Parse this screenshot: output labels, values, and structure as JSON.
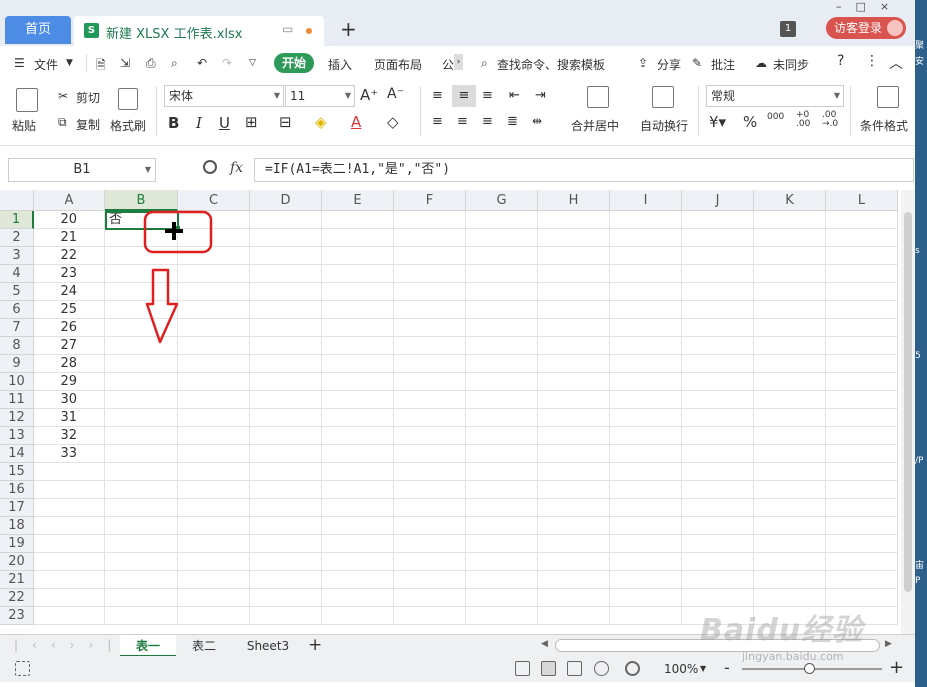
{
  "tabs": {
    "home_label": "首页",
    "file_label": "新建 XLSX 工作表.xlsx",
    "file_icon": "S",
    "new_tab": "+",
    "window_count": "1",
    "login_label": "访客登录"
  },
  "menu": {
    "items": [
      "文件",
      "开始",
      "插入",
      "页面布局",
      "公",
      "查找命令、搜索模板",
      "分享",
      "批注",
      "未同步"
    ],
    "help": "?",
    "more": "⋮"
  },
  "ribbon": {
    "paste": "粘贴",
    "cut": "剪切",
    "copy": "复制",
    "format_painter": "格式刷",
    "font_name": "宋体",
    "font_size": "11",
    "bold": "B",
    "italic": "I",
    "underline": "U",
    "merge_center": "合并居中",
    "wrap_text": "自动换行",
    "number_format": "常规",
    "percent": "%",
    "conditional_format": "条件格式"
  },
  "formula_bar": {
    "name_box": "B1",
    "fx": "fx",
    "formula": "=IF(A1=表二!A1,\"是\",\"否\")"
  },
  "grid": {
    "columns": [
      "A",
      "B",
      "C",
      "D",
      "E",
      "F",
      "G",
      "H",
      "I",
      "J",
      "K",
      "L"
    ],
    "rows": [
      "1",
      "2",
      "3",
      "4",
      "5",
      "6",
      "7",
      "8",
      "9",
      "10",
      "11",
      "12",
      "13",
      "14",
      "15",
      "16",
      "17",
      "18",
      "19",
      "20",
      "21",
      "22",
      "23"
    ],
    "col_a_values": [
      "20",
      "21",
      "22",
      "23",
      "24",
      "25",
      "26",
      "27",
      "28",
      "29",
      "30",
      "31",
      "32",
      "33"
    ],
    "b1_value": "否",
    "selected_cell": "B1"
  },
  "sheets": {
    "tabs": [
      "表一",
      "表二",
      "Sheet3"
    ],
    "active": "表一",
    "add": "+"
  },
  "status": {
    "zoom": "100%",
    "minus": "-",
    "plus": "+"
  },
  "watermark": {
    "brand": "Baidu经验",
    "url": "jingyan.baidu.com"
  },
  "colors": {
    "accent_green": "#1d7d3e",
    "home_tab_blue": "#4d8ce5",
    "login_red": "#d9534f",
    "annotation_red": "#e02020"
  }
}
